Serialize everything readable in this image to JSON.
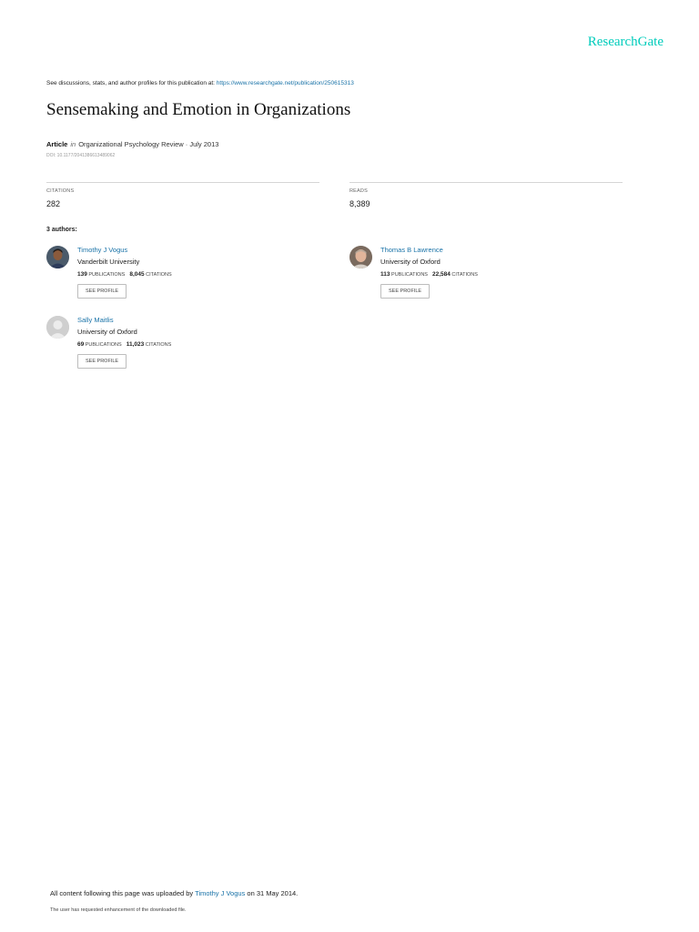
{
  "header": {
    "logo": "ResearchGate"
  },
  "disclaimer": {
    "text": "See discussions, stats, and author profiles for this publication at: ",
    "url": "https://www.researchgate.net/publication/250615313"
  },
  "publication": {
    "title": "Sensemaking and Emotion in Organizations",
    "type": "Article",
    "in_label": "in",
    "journal_date": "Organizational Psychology Review · July 2013",
    "doi": "DOI: 10.1177/2041386613489062"
  },
  "stats": {
    "citations_label": "CITATIONS",
    "citations_value": "282",
    "reads_label": "READS",
    "reads_value": "8,389"
  },
  "authors_heading": "3 authors:",
  "authors": [
    {
      "name": "Timothy J Vogus",
      "affiliation": "Vanderbilt University",
      "publications": "139",
      "publications_label": "PUBLICATIONS",
      "citations": "8,045",
      "citations_label": "CITATIONS",
      "button": "SEE PROFILE"
    },
    {
      "name": "Thomas B Lawrence",
      "affiliation": "University of Oxford",
      "publications": "113",
      "publications_label": "PUBLICATIONS",
      "citations": "22,584",
      "citations_label": "CITATIONS",
      "button": "SEE PROFILE"
    },
    {
      "name": "Sally Maitlis",
      "affiliation": "University of Oxford",
      "publications": "69",
      "publications_label": "PUBLICATIONS",
      "citations": "11,023",
      "citations_label": "CITATIONS",
      "button": "SEE PROFILE"
    }
  ],
  "footer": {
    "uploaded_prefix": "All content following this page was uploaded by ",
    "uploader": "Timothy J Vogus",
    "uploaded_suffix": " on 31 May 2014.",
    "note": "The user has requested enhancement of the downloaded file."
  }
}
